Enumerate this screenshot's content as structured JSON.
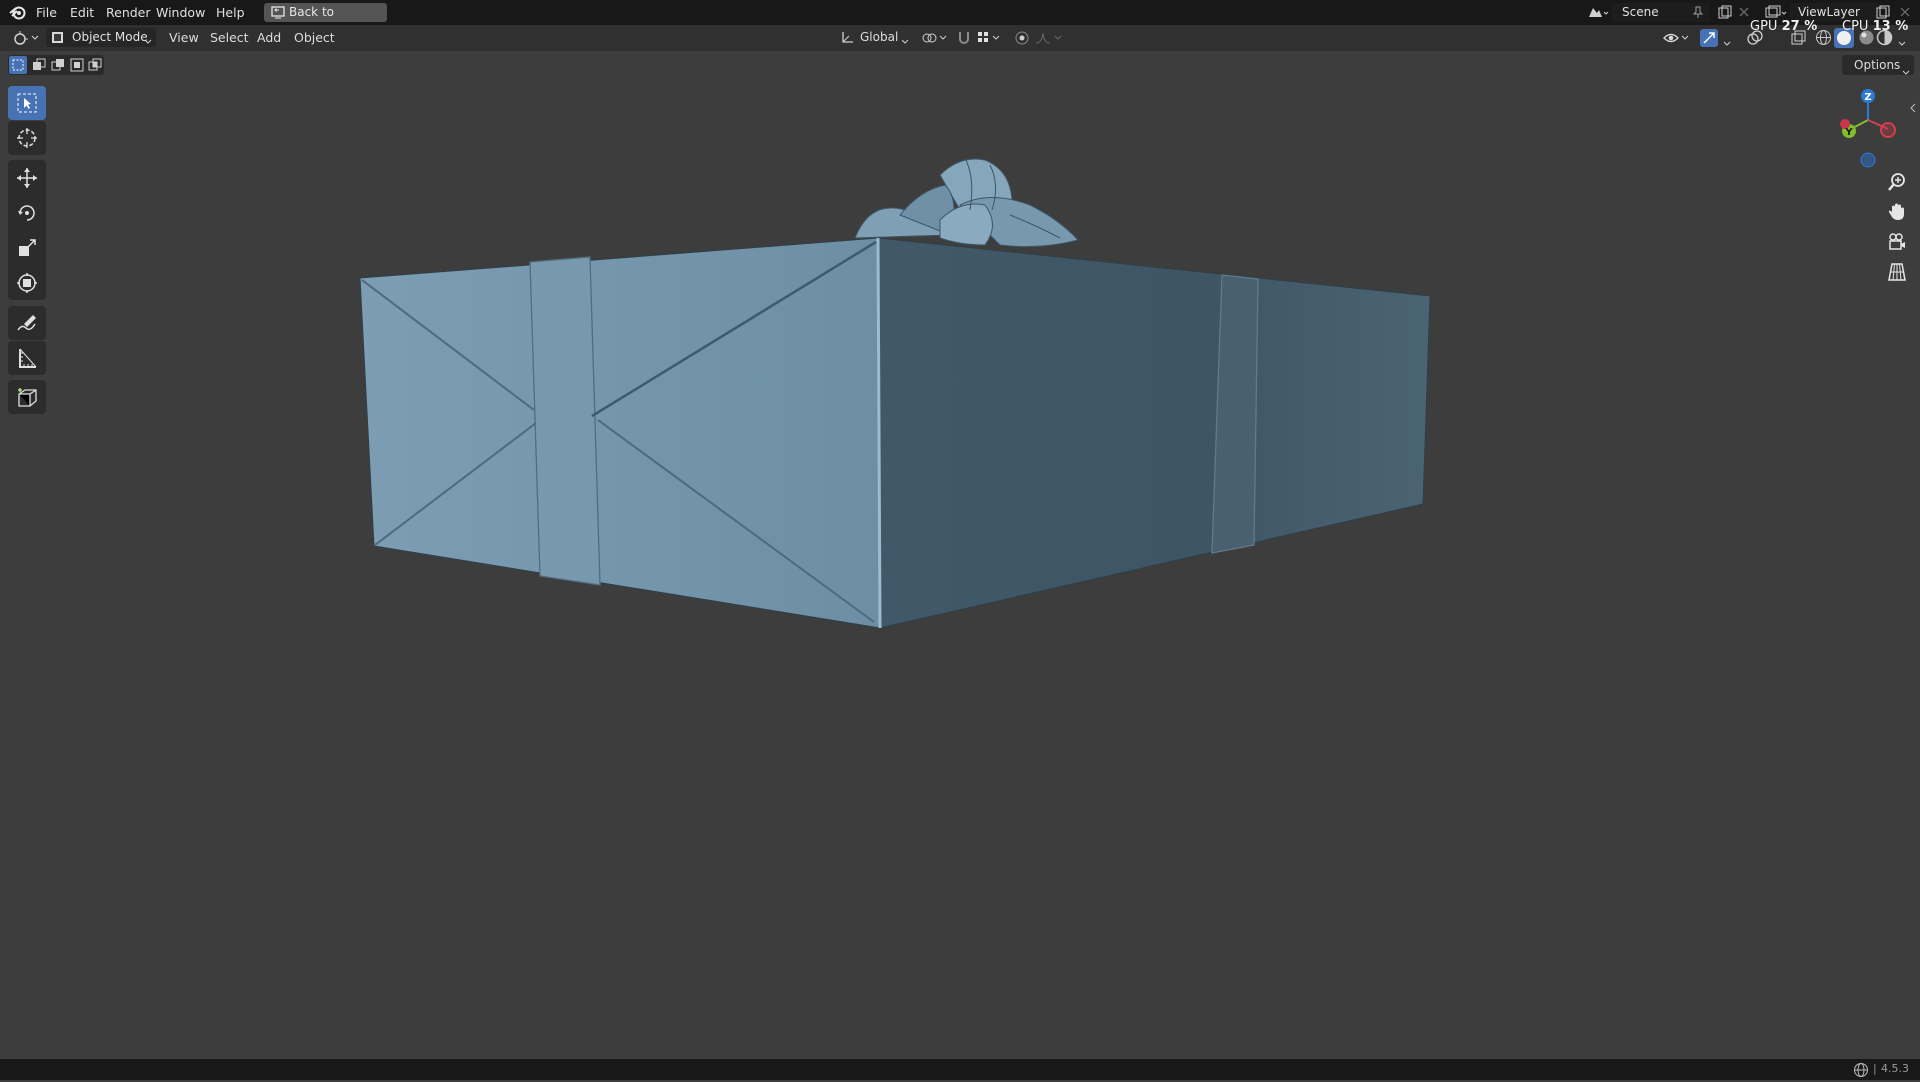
{
  "menubar": {
    "items": [
      "File",
      "Edit",
      "Render",
      "Window",
      "Help"
    ],
    "back_label": "Back to Previous",
    "scene_name": "Scene",
    "view_layer": "ViewLayer",
    "gpu_label": "GPU",
    "gpu_value": "27 %",
    "cpu_label": "CPU",
    "cpu_value": "13 %"
  },
  "header": {
    "mode": "Object Mode",
    "menus": [
      "View",
      "Select",
      "Add",
      "Object"
    ],
    "orientation": "Global",
    "options_label": "Options"
  },
  "toolbar": {
    "tools": [
      "select-box",
      "cursor",
      "move",
      "rotate",
      "scale",
      "transform",
      "annotate",
      "measure",
      "add-cube"
    ],
    "active": "select-box"
  },
  "viewport": {
    "object": "gift-box",
    "object_color": "#6e92aa",
    "background_color": "#3d3d3d"
  },
  "gizmo": {
    "z_label": "Z",
    "y_label": "Y",
    "x_color": "#d2404e",
    "y_color": "#82be2a",
    "z_color": "#2c79d6"
  },
  "status": {
    "version": "4.5.3"
  },
  "colors": {
    "accent": "#4772b3",
    "panel": "#303030",
    "topbar": "#181818"
  }
}
